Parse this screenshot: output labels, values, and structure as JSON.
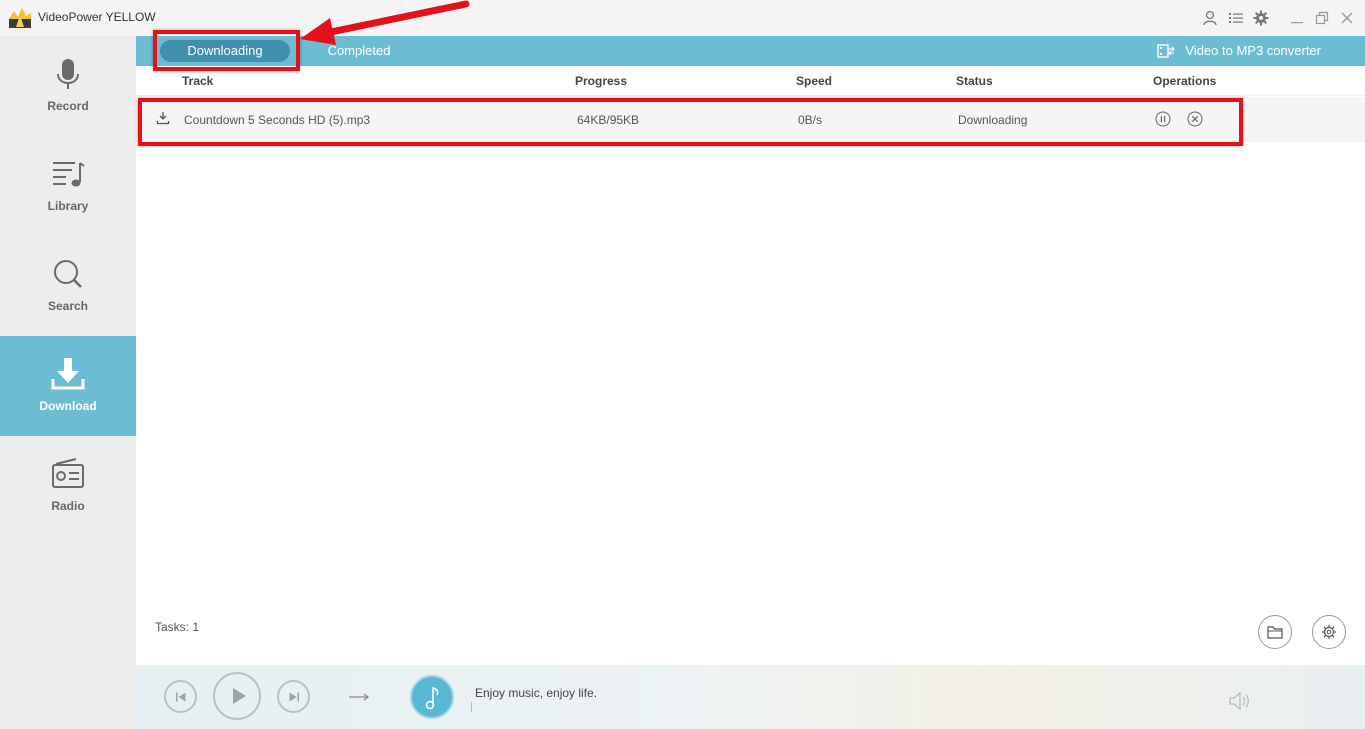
{
  "app": {
    "title": "VideoPower YELLOW"
  },
  "sidebar": {
    "items": [
      {
        "label": "Record",
        "icon": "microphone-icon"
      },
      {
        "label": "Library",
        "icon": "library-icon"
      },
      {
        "label": "Search",
        "icon": "search-icon"
      },
      {
        "label": "Download",
        "icon": "download-icon",
        "active": true
      },
      {
        "label": "Radio",
        "icon": "radio-icon"
      }
    ]
  },
  "tabs": [
    {
      "label": "Downloading",
      "active": true
    },
    {
      "label": "Completed"
    }
  ],
  "converter_label": "Video to MP3 converter",
  "table": {
    "headers": {
      "track": "Track",
      "progress": "Progress",
      "speed": "Speed",
      "status": "Status",
      "operations": "Operations"
    },
    "rows": [
      {
        "track": "Countdown 5 Seconds HD (5).mp3",
        "progress": "64KB/95KB",
        "speed": "0B/s",
        "status": "Downloading"
      }
    ]
  },
  "footer": {
    "tasks": "Tasks: 1"
  },
  "player": {
    "tagline": "Enjoy music, enjoy life."
  },
  "colors": {
    "accent": "#6cbcd4",
    "tab_active": "#3f8fad",
    "annotation": "#e4101a"
  }
}
